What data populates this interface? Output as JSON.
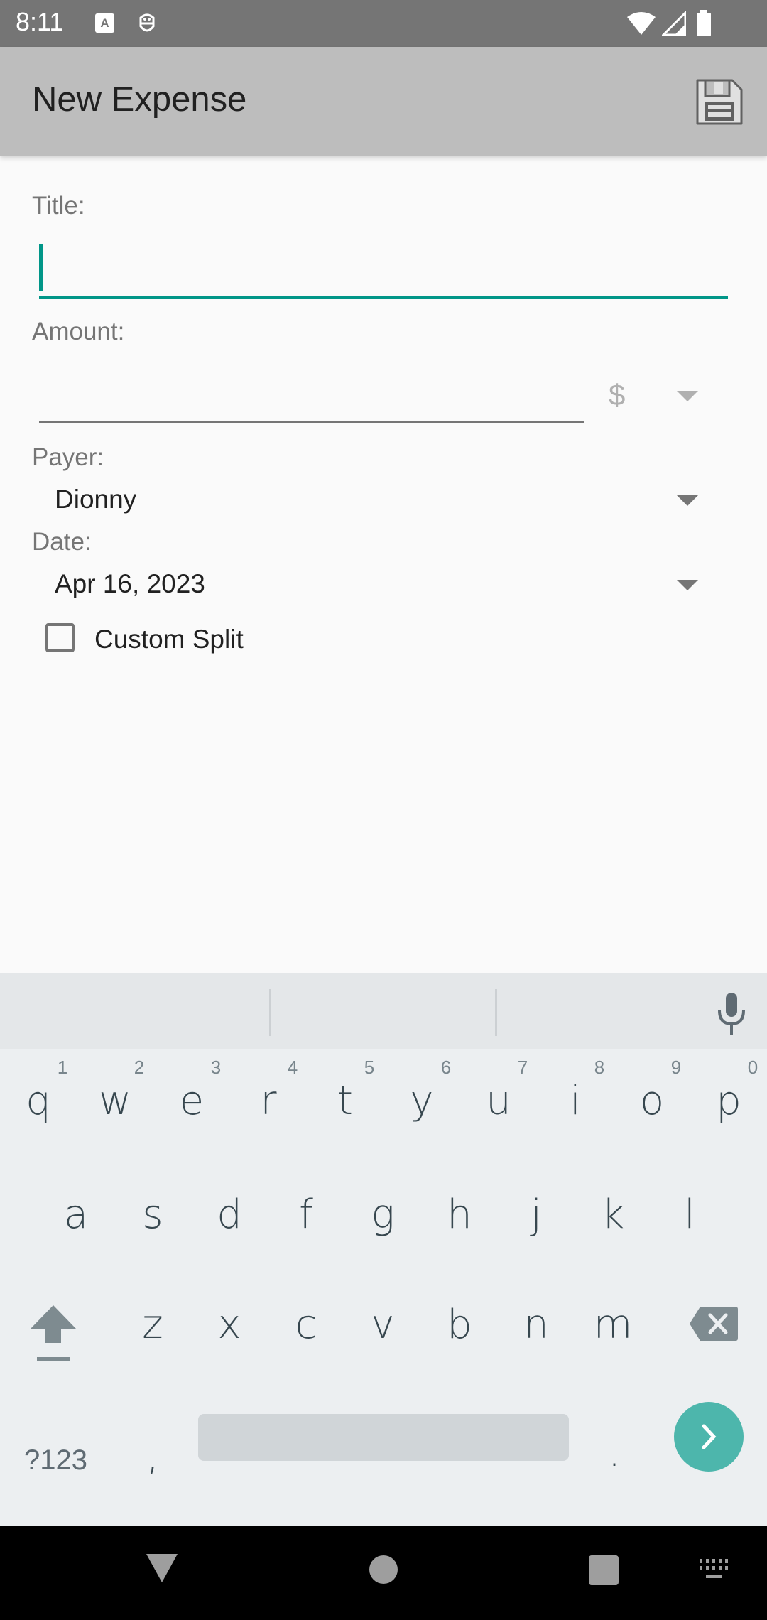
{
  "status_bar": {
    "time": "8:11",
    "icons_left": [
      "keyboard-a-icon",
      "debug-bot-icon"
    ],
    "icons_right": [
      "wifi-icon",
      "cell-signal-icon",
      "battery-icon"
    ]
  },
  "app_bar": {
    "title": "New Expense",
    "action_icon": "save-icon"
  },
  "form": {
    "title_label": "Title:",
    "title_value": "",
    "amount_label": "Amount:",
    "amount_value": "",
    "currency": "$",
    "payer_label": "Payer:",
    "payer_value": "Dionny",
    "date_label": "Date:",
    "date_value": "Apr 16, 2023",
    "custom_split_label": "Custom Split",
    "custom_split_checked": false
  },
  "colors": {
    "accent": "#009688",
    "enter_button": "#4db6ac"
  },
  "keyboard": {
    "row1": [
      "q",
      "w",
      "e",
      "r",
      "t",
      "y",
      "u",
      "i",
      "o",
      "p"
    ],
    "row1_hints": [
      "1",
      "2",
      "3",
      "4",
      "5",
      "6",
      "7",
      "8",
      "9",
      "0"
    ],
    "row2": [
      "a",
      "s",
      "d",
      "f",
      "g",
      "h",
      "j",
      "k",
      "l"
    ],
    "row3": [
      "z",
      "x",
      "c",
      "v",
      "b",
      "n",
      "m"
    ],
    "symbols_label": "?123",
    "comma": ",",
    "period": "."
  }
}
